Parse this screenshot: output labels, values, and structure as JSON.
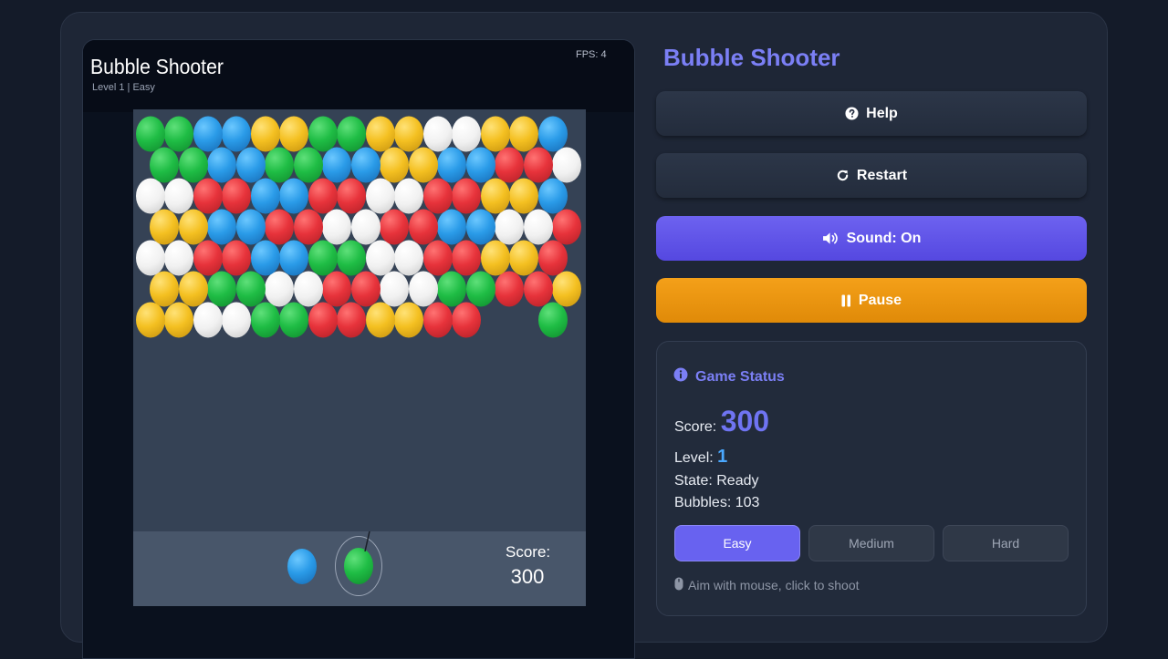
{
  "game": {
    "title": "Bubble Shooter",
    "subtitle": "Level 1 | Easy",
    "fps": "FPS: 4",
    "score_label": "Score:",
    "score_value": "300",
    "next_bubble_color": "blue",
    "current_bubble_color": "green",
    "grid": [
      [
        "green",
        "green",
        "blue",
        "blue",
        "yellow",
        "yellow",
        "green",
        "green",
        "yellow",
        "yellow",
        "white",
        "white",
        "yellow",
        "yellow",
        "blue"
      ],
      [
        "green",
        "green",
        "blue",
        "blue",
        "green",
        "green",
        "blue",
        "blue",
        "yellow",
        "yellow",
        "blue",
        "blue",
        "red",
        "red",
        "white"
      ],
      [
        "white",
        "white",
        "red",
        "red",
        "blue",
        "blue",
        "red",
        "red",
        "white",
        "white",
        "red",
        "red",
        "yellow",
        "yellow",
        "blue"
      ],
      [
        "yellow",
        "yellow",
        "blue",
        "blue",
        "red",
        "red",
        "white",
        "white",
        "red",
        "red",
        "blue",
        "blue",
        "white",
        "white",
        "red"
      ],
      [
        "white",
        "white",
        "red",
        "red",
        "blue",
        "blue",
        "green",
        "green",
        "white",
        "white",
        "red",
        "red",
        "yellow",
        "yellow",
        "red"
      ],
      [
        "yellow",
        "yellow",
        "green",
        "green",
        "white",
        "white",
        "red",
        "red",
        "white",
        "white",
        "green",
        "green",
        "red",
        "red",
        "yellow"
      ],
      [
        "yellow",
        "yellow",
        "white",
        "white",
        "green",
        "green",
        "red",
        "red",
        "yellow",
        "yellow",
        "red",
        "red",
        null,
        null,
        "green"
      ]
    ]
  },
  "sidebar": {
    "title": "Bubble Shooter",
    "help_label": "Help",
    "restart_label": "Restart",
    "sound_label": "Sound: On",
    "pause_label": "Pause"
  },
  "status": {
    "header": "Game Status",
    "score_label": "Score:",
    "score_value": "300",
    "level_label": "Level:",
    "level_value": "1",
    "state": "State: Ready",
    "bubbles": "Bubbles: 103",
    "difficulty": {
      "easy": "Easy",
      "medium": "Medium",
      "hard": "Hard",
      "selected": "easy"
    },
    "hint": "Aim with mouse, click to shoot"
  },
  "colors": {
    "accent": "#7b7ff5",
    "sound_button": "#5f55ea",
    "pause_button": "#f29612",
    "level_value": "#4aa8ff"
  },
  "icons": {
    "help": "question-circle-icon",
    "restart": "rotate-icon",
    "sound": "volume-icon",
    "pause": "pause-icon",
    "status": "info-circle-icon",
    "hint": "mouse-icon"
  }
}
